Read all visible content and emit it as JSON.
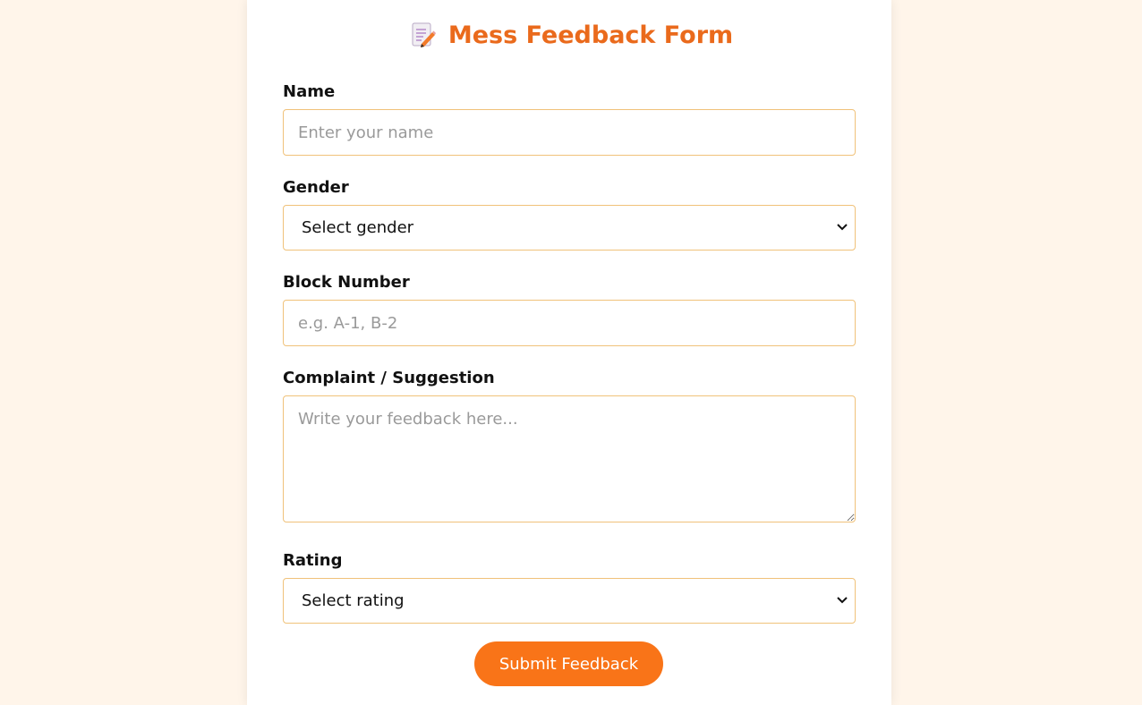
{
  "form": {
    "title": "Mess Feedback Form",
    "title_icon": "memo-pencil-icon",
    "name": {
      "label": "Name",
      "placeholder": "Enter your name",
      "value": ""
    },
    "gender": {
      "label": "Gender",
      "selected": "Select gender"
    },
    "block": {
      "label": "Block Number",
      "placeholder": "e.g. A-1, B-2",
      "value": ""
    },
    "complaint": {
      "label": "Complaint / Suggestion",
      "placeholder": "Write your feedback here...",
      "value": ""
    },
    "rating": {
      "label": "Rating",
      "selected": "Select rating"
    },
    "submit_label": "Submit Feedback"
  },
  "colors": {
    "page_background": "#fff5ea",
    "accent": "#f97418",
    "title": "#ea6a1c",
    "field_border": "#f0c27a"
  }
}
